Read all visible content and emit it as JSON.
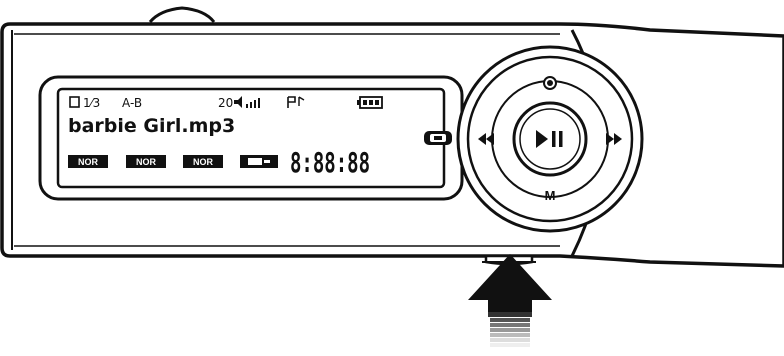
{
  "display": {
    "track_index": "1⁄3",
    "ab_repeat": "A-B",
    "volume": "20",
    "filename": "barbie Girl.mp3",
    "time": "8:88:88",
    "eq_tags": [
      "NOR",
      "NOR",
      "NOR"
    ]
  },
  "controls": {
    "center_label": "▶II",
    "bottom_label": "M",
    "left_symbol": "◀◀",
    "right_symbol": "▶▶"
  },
  "colors": {
    "ink": "#111111",
    "background": "#ffffff"
  }
}
